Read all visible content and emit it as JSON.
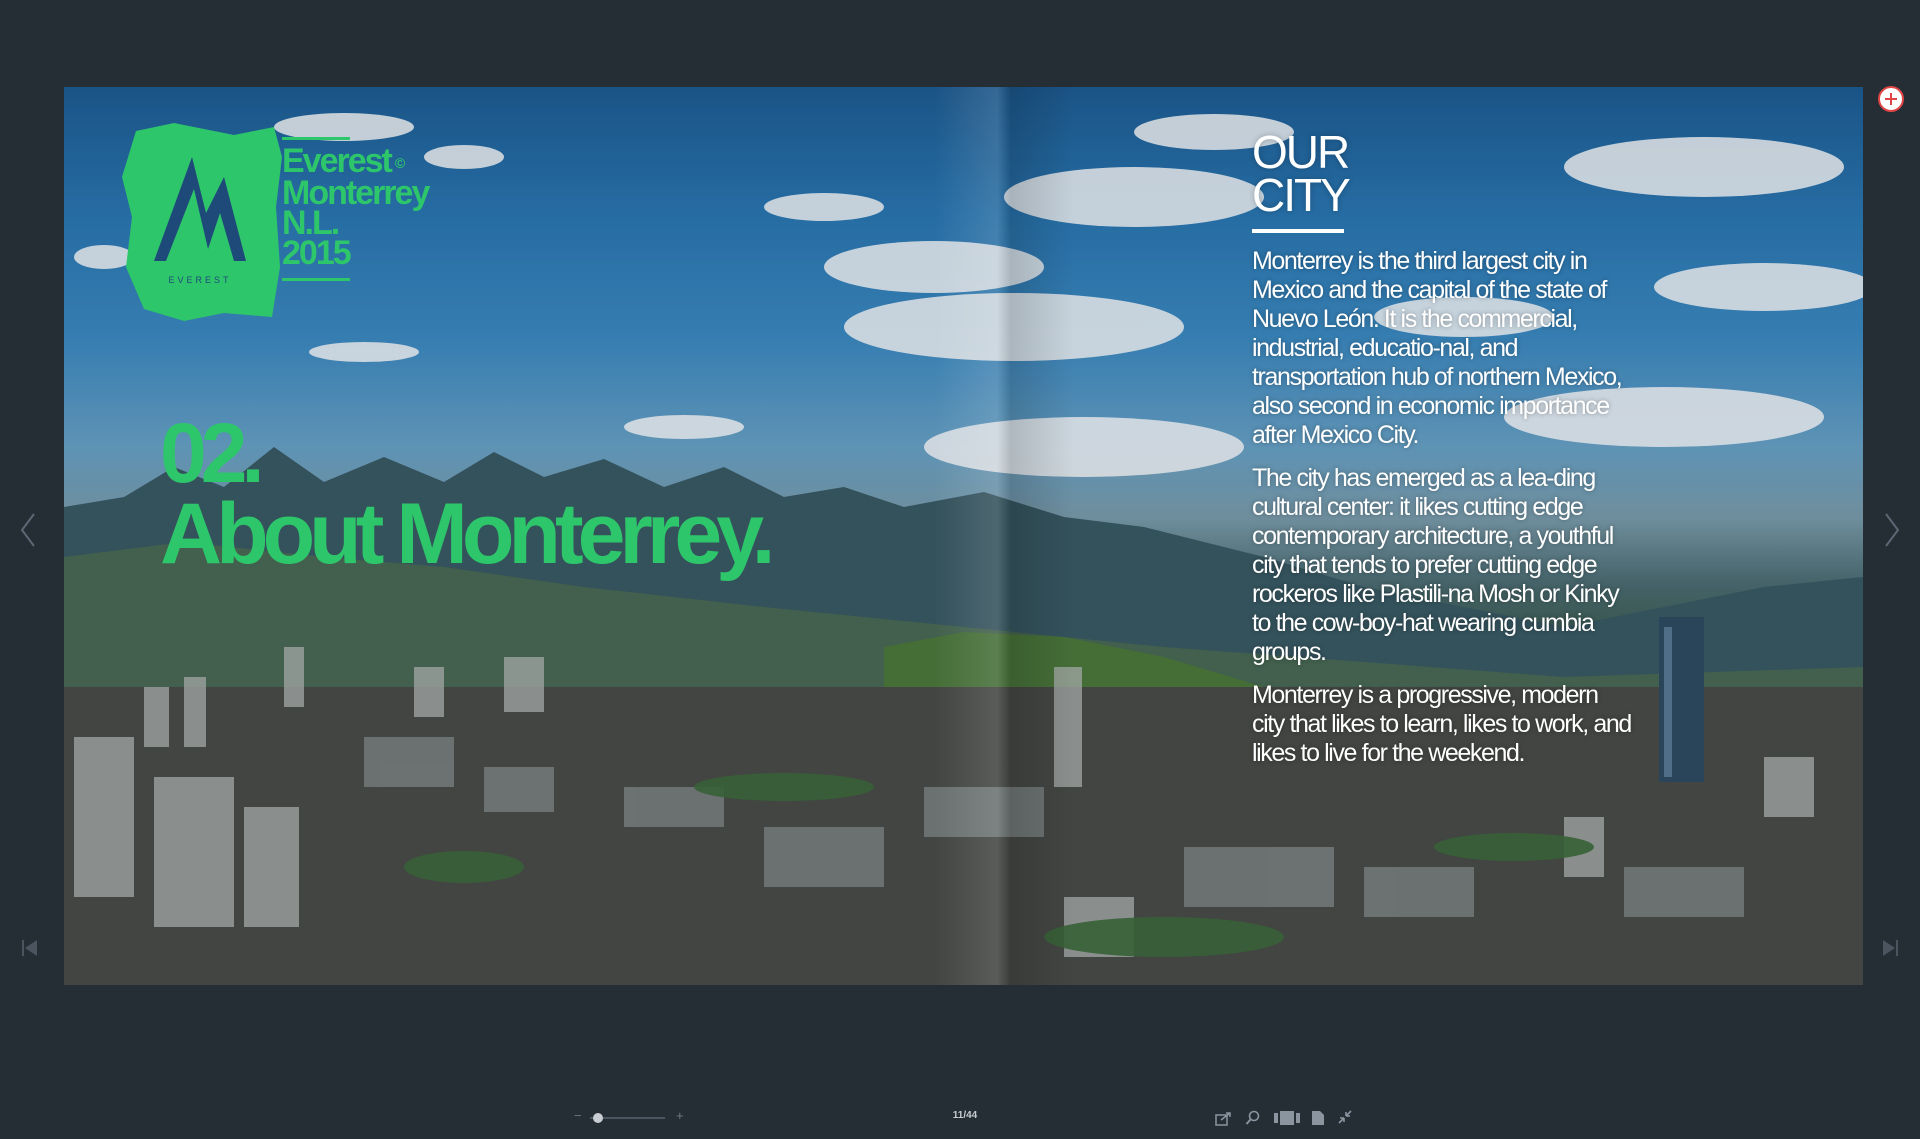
{
  "spread": {
    "logo": {
      "brand_line1": "Everest",
      "copyright_mark": "©",
      "brand_line2": "Monterrey",
      "brand_line3": "N.L.",
      "brand_line4": "2015",
      "emblem_text": "EVEREST"
    },
    "section_number": "02.",
    "section_title": "About Monterrey.",
    "city": {
      "heading_line1": "OUR",
      "heading_line2": "CITY",
      "paragraphs": [
        "Monterrey is the third largest city in Mexico and the capital of the state of Nuevo León. It is the commercial, industrial, educatio-nal, and transportation hub of northern Mexico, also second in economic importance after Mexico City.",
        "The city has emerged as a lea-ding cultural center: it likes cutting edge contemporary architecture, a youthful city that tends to prefer cutting edge rockeros like Plastili-na Mosh or Kinky to the cow-boy-hat wearing cumbia groups.",
        "Monterrey is a progressive, modern city that likes to learn, likes to work, and likes to live for the weekend."
      ]
    },
    "accent_color": "#2ec66b"
  },
  "viewer": {
    "prev_icon": "chevron-left-icon",
    "next_icon": "chevron-right-icon",
    "first_icon": "skip-first-icon",
    "last_icon": "skip-last-icon",
    "fullscreen_icon": "plus-circle-icon",
    "toolbar": {
      "zoom_minus": "−",
      "zoom_plus": "+",
      "zoom_level": 0.04,
      "page_counter": "11/44",
      "icons": [
        "share-icon",
        "search-icon",
        "thumbnails-icon",
        "document-icon",
        "exit-fullscreen-icon"
      ]
    }
  }
}
